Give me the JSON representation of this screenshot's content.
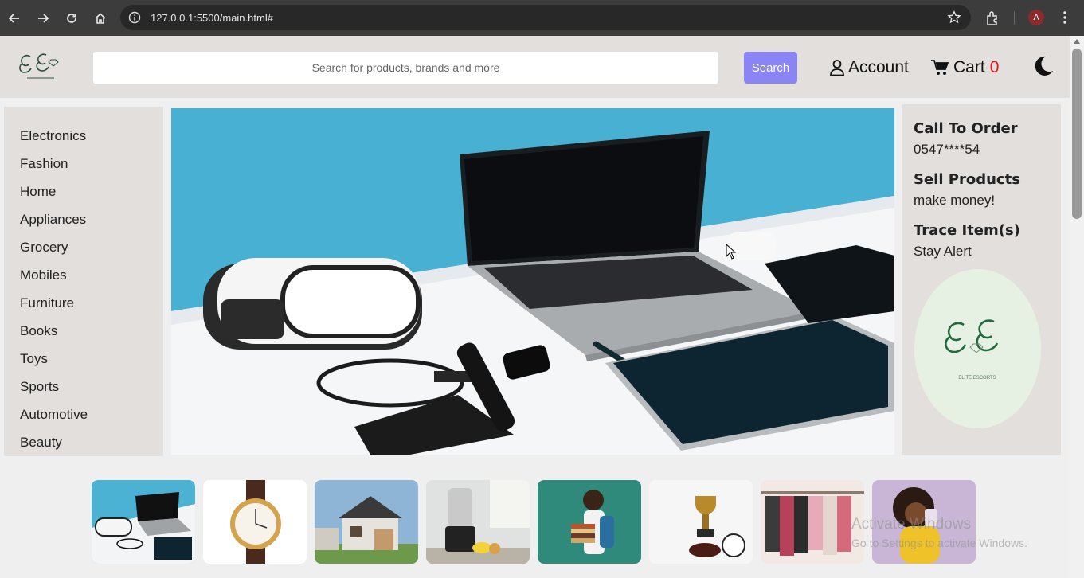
{
  "browser": {
    "url": "127.0.0.1:5500/main.html#",
    "profile_initial": "A"
  },
  "header": {
    "search_placeholder": "Search for products, brands and more",
    "search_button": "Search",
    "account_label": "Account",
    "cart_label": "Cart",
    "cart_count": "0"
  },
  "sidebar": {
    "categories": [
      "Electronics",
      "Fashion",
      "Home",
      "Appliances",
      "Grocery",
      "Mobiles",
      "Furniture",
      "Books",
      "Toys",
      "Sports",
      "Automotive",
      "Beauty"
    ]
  },
  "info_panel": {
    "call_title": "Call To Order",
    "call_number": "0547****54",
    "sell_title": "Sell Products",
    "sell_text": "make money!",
    "trace_title": "Trace Item(s)",
    "trace_text": "Stay Alert",
    "badge_brand": "ELITE ESCORTS"
  },
  "thumbnails": [
    "electronics-photo",
    "watch-photo",
    "house-photo",
    "blender-photo",
    "books-photo",
    "sports-trophy-photo",
    "clothes-rack-photo",
    "beauty-photo"
  ],
  "watermark": {
    "line1": "Activate Windows",
    "line2": "Go to Settings to activate Windows."
  },
  "colors": {
    "header_bg": "#e3dfdc",
    "search_button": "#8a84f5",
    "cart_count": "#ee1111",
    "chrome_bg": "#3c3c3c"
  }
}
